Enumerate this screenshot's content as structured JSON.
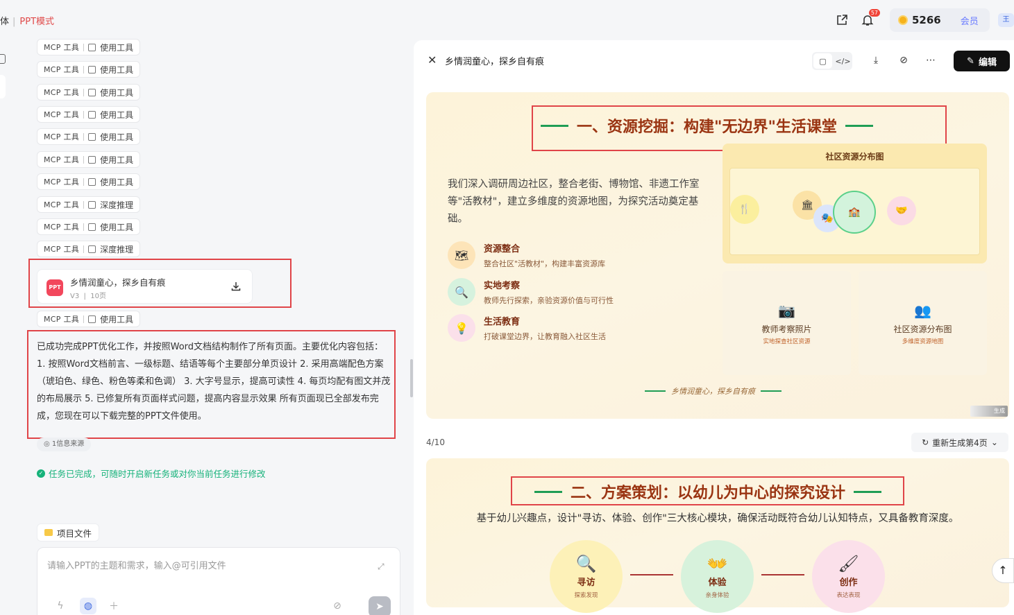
{
  "topbar": {
    "crumb_left": "体",
    "crumb_mode": "PPT模式",
    "notif_count": "57",
    "points": "5266",
    "vip_label": "会员",
    "avatar_text": "王"
  },
  "chat": {
    "tool_prefix": "MCP 工具",
    "tool_calls": [
      "使用工具",
      "使用工具",
      "使用工具",
      "使用工具",
      "使用工具",
      "使用工具",
      "使用工具",
      "深度推理",
      "使用工具",
      "深度推理"
    ],
    "last_tool": "使用工具",
    "file_card": {
      "title": "乡情润童心，探乡自有痕",
      "version": "V3",
      "pages": "10页",
      "icon_text": "PPT"
    },
    "summary": "已成功完成PPT优化工作，并按照Word文档结构制作了所有页面。主要优化内容包括： 1. 按照Word文档前言、一级标题、结语等每个主要部分单页设计 2. 采用高端配色方案（琥珀色、绿色、粉色等柔和色调） 3. 大字号显示，提高可读性 4. 每页均配有图文并茂的布局展示 5. 已修复所有页面样式问题，提高内容显示效果 所有页面现已全部发布完成，您现在可以下载完整的PPT文件使用。",
    "source_label": "1信息来源",
    "done_label": "任务已完成，可随时开启新任务或对你当前任务进行修改",
    "project_files": "项目文件",
    "input_placeholder": "请输入PPT的主题和需求，输入@可引用文件"
  },
  "panel": {
    "title": "乡情润童心，探乡自有痕",
    "edit_label": "编辑",
    "page_indicator": "4/10",
    "regen_label": "重新生成第4页",
    "slide4": {
      "title": "一、资源挖掘：构建\"无边界\"生活课堂",
      "intro": "我们深入调研周边社区，整合老街、博物馆、非遗工作室等\"活教材\"，建立多维度的资源地图，为探究活动奠定基础。",
      "features": [
        {
          "title": "资源整合",
          "desc": "整合社区\"活教材\"，构建丰富资源库",
          "icon": "map-icon",
          "color": "#fde4b8"
        },
        {
          "title": "实地考察",
          "desc": "教师先行探索，亲验资源价值与可行性",
          "icon": "search-icon",
          "color": "#d6f2de"
        },
        {
          "title": "生活教育",
          "desc": "打破课堂边界，让教育融入社区生活",
          "icon": "bulb-icon",
          "color": "#fbe0ea"
        }
      ],
      "map_title": "社区资源分布图",
      "cards": [
        {
          "title": "教师考察照片",
          "desc": "实地探查社区资源"
        },
        {
          "title": "社区资源分布图",
          "desc": "多维度资源地图"
        }
      ],
      "footer": "乡情润童心，探乡自有痕",
      "watermark": "生成"
    },
    "slide5": {
      "title": "二、方案策划：以幼儿为中心的探究设计",
      "subtitle": "基于幼儿兴趣点，设计\"寻访、体验、创作\"三大核心模块，确保活动既符合幼儿认知特点，又具备教育深度。",
      "modules": [
        {
          "title": "寻访",
          "desc": "探索发现",
          "color": "#fdf1b8"
        },
        {
          "title": "体验",
          "desc": "亲身体验",
          "color": "#d7f2dc"
        },
        {
          "title": "创作",
          "desc": "表达表现",
          "color": "#fbe0ea"
        }
      ]
    }
  }
}
